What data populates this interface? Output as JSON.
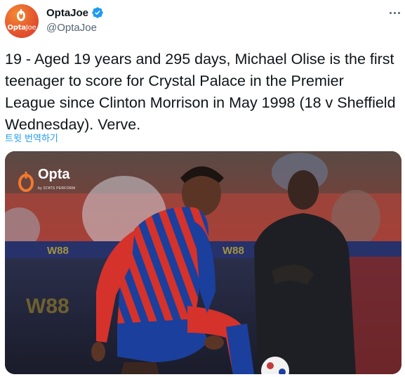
{
  "account": {
    "display_name": "OptaJoe",
    "handle": "@OptaJoe",
    "verified": true,
    "avatar_brand": "Opta",
    "avatar_brand_suffix": "Joe",
    "avatar_icon": "opta-o-logo"
  },
  "tweet": {
    "text": "19 - Aged 19 years and 295 days, Michael Olise is the first teenager to score for Crystal Palace in the Premier League since Clinton Morrison in May 1998 (18 v Sheffield Wednesday). Verve.",
    "translate_label": "트윗 번역하기"
  },
  "media": {
    "watermark_brand": "Opta",
    "watermark_sub": "by STATS PERFORM",
    "board_text": "W88"
  },
  "icons": {
    "more": "more-horizontal-icon",
    "verified": "verified-badge-icon"
  },
  "colors": {
    "link_blue": "#1d9bf0",
    "verified_blue": "#1d9bf0",
    "secondary_text": "#536471",
    "opta_orange": "#e4572e",
    "palace_red": "#d5322b",
    "palace_blue": "#1b3f9c"
  }
}
